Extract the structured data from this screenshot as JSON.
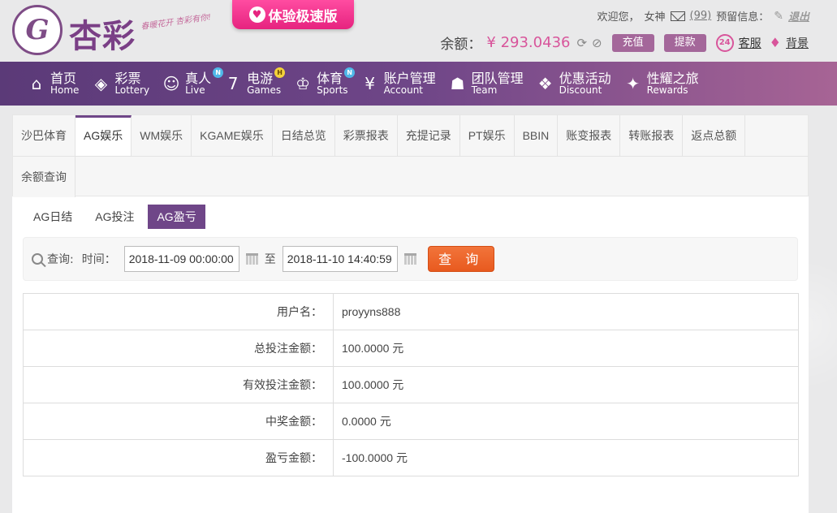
{
  "brand": {
    "emblem": "G",
    "name": "杏彩",
    "slogan": "春暖花开 杏彩有你!",
    "fast_version": "体验极速版"
  },
  "header": {
    "welcome": "欢迎您，",
    "username": "女神",
    "mail_count": "(99)",
    "alert_label": "预留信息：",
    "logout": "退出",
    "balance_label": "余额：",
    "balance_value": "¥ 293.0436",
    "recharge": "充值",
    "withdraw": "提款",
    "service": "客服",
    "background": "背景",
    "service_badge": "24"
  },
  "nav": [
    {
      "cn": "首页",
      "en": "Home",
      "icon": "home-icon",
      "glyph": "⌂",
      "badge": ""
    },
    {
      "cn": "彩票",
      "en": "Lottery",
      "icon": "lottery-icon",
      "glyph": "◈",
      "badge": ""
    },
    {
      "cn": "真人",
      "en": "Live",
      "icon": "live-icon",
      "glyph": "☺",
      "badge": "N"
    },
    {
      "cn": "电游",
      "en": "Games",
      "icon": "games-icon",
      "glyph": "7",
      "badge": "H"
    },
    {
      "cn": "体育",
      "en": "Sports",
      "icon": "sports-icon",
      "glyph": "♔",
      "badge": "N"
    },
    {
      "cn": "账户管理",
      "en": "Account",
      "icon": "account-icon",
      "glyph": "¥",
      "badge": ""
    },
    {
      "cn": "团队管理",
      "en": "Team",
      "icon": "team-icon",
      "glyph": "☗",
      "badge": ""
    },
    {
      "cn": "优惠活动",
      "en": "Discount",
      "icon": "gift-icon",
      "glyph": "❖",
      "badge": ""
    },
    {
      "cn": "性耀之旅",
      "en": "Rewards",
      "icon": "rewards-icon",
      "glyph": "✦",
      "badge": ""
    }
  ],
  "tabs": [
    "沙巴体育",
    "AG娱乐",
    "WM娱乐",
    "KGAME娱乐",
    "日结总览",
    "彩票报表",
    "充提记录",
    "PT娱乐",
    "BBIN",
    "账变报表",
    "转账报表",
    "返点总额"
  ],
  "tabs_row2": [
    "余额查询"
  ],
  "active_tab": "AG娱乐",
  "subtabs": [
    "AG日结",
    "AG投注",
    "AG盈亏"
  ],
  "active_subtab": "AG盈亏",
  "query": {
    "label": "查询:",
    "time_label": "时间：",
    "start": "2018-11-09 00:00:00",
    "to": "至",
    "end": "2018-11-10 14:40:59",
    "button": "查 询"
  },
  "rows": [
    {
      "label": "用户名：",
      "value": "proyyns888"
    },
    {
      "label": "总投注金额：",
      "value": "100.0000 元"
    },
    {
      "label": "有效投注金额：",
      "value": "100.0000 元"
    },
    {
      "label": "中奖金额：",
      "value": "0.0000 元"
    },
    {
      "label": "盈亏金额：",
      "value": "-100.0000 元"
    }
  ]
}
